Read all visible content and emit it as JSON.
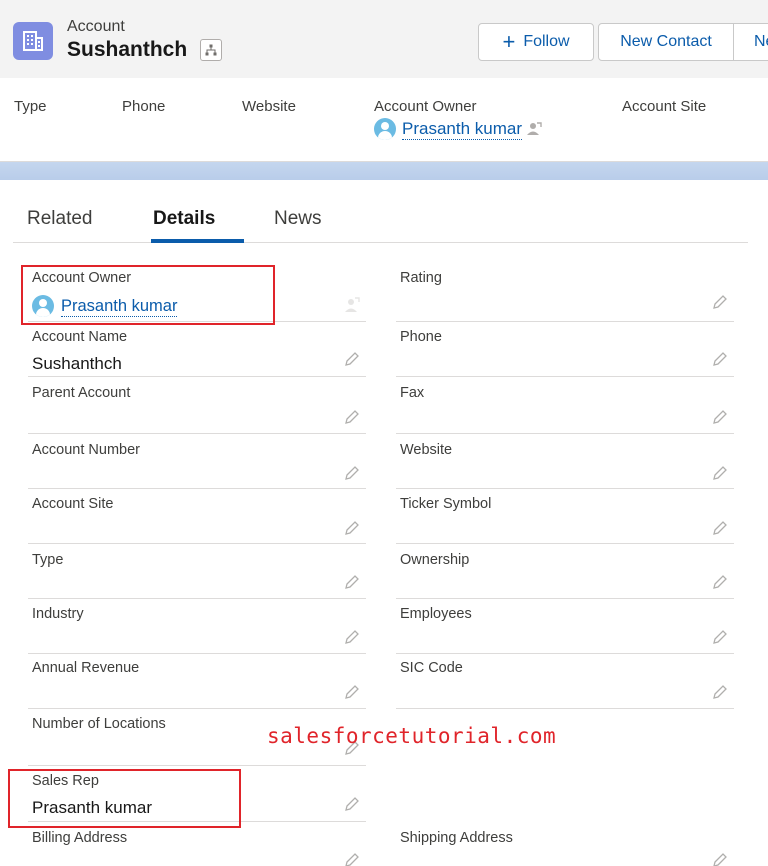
{
  "header": {
    "object_label": "Account",
    "record_name": "Sushanthch",
    "object_icon": "account-building-icon",
    "hierarchy_icon": "hierarchy-icon",
    "actions": {
      "follow_label": "Follow",
      "new_contact_label": "New Contact",
      "more_label_partial": "Ne"
    },
    "accent_color": "#0b5cab",
    "icon_color": "#7f8de1"
  },
  "highlights": {
    "type_label": "Type",
    "phone_label": "Phone",
    "website_label": "Website",
    "account_owner_label": "Account Owner",
    "account_owner_value": "Prasanth kumar",
    "account_site_label": "Account Site"
  },
  "tabs": {
    "related": "Related",
    "details": "Details",
    "news": "News",
    "active": "Details"
  },
  "details": {
    "account_owner": {
      "label": "Account Owner",
      "value": "Prasanth kumar"
    },
    "rating": {
      "label": "Rating",
      "value": ""
    },
    "account_name": {
      "label": "Account Name",
      "value": "Sushanthch"
    },
    "phone": {
      "label": "Phone",
      "value": ""
    },
    "parent_account": {
      "label": "Parent Account",
      "value": ""
    },
    "fax": {
      "label": "Fax",
      "value": ""
    },
    "account_number": {
      "label": "Account Number",
      "value": ""
    },
    "website": {
      "label": "Website",
      "value": ""
    },
    "account_site": {
      "label": "Account Site",
      "value": ""
    },
    "ticker_symbol": {
      "label": "Ticker Symbol",
      "value": ""
    },
    "type": {
      "label": "Type",
      "value": ""
    },
    "ownership": {
      "label": "Ownership",
      "value": ""
    },
    "industry": {
      "label": "Industry",
      "value": ""
    },
    "employees": {
      "label": "Employees",
      "value": ""
    },
    "annual_revenue": {
      "label": "Annual Revenue",
      "value": ""
    },
    "sic_code": {
      "label": "SIC Code",
      "value": ""
    },
    "number_of_locations": {
      "label": "Number of Locations",
      "value": ""
    },
    "sales_rep": {
      "label": "Sales Rep",
      "value": "Prasanth kumar"
    },
    "billing_address": {
      "label": "Billing Address",
      "value": ""
    },
    "shipping_address": {
      "label": "Shipping Address",
      "value": ""
    }
  },
  "watermark": "salesforcetutorial.com",
  "highlight_color": "#e0242a"
}
